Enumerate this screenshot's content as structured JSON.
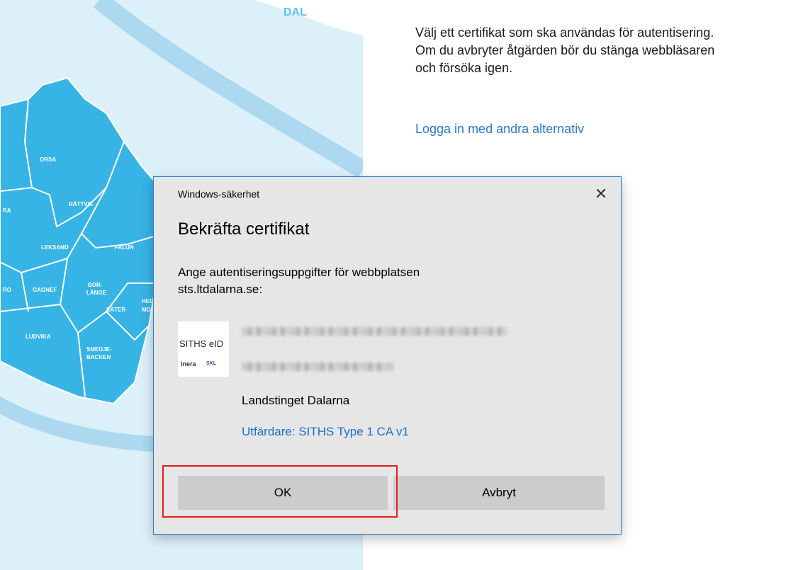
{
  "page": {
    "instruction_lines": [
      "Välj ett certifikat som ska användas för autentisering.",
      "Om du avbryter åtgärden bör du stänga webbläsaren",
      "och försöka igen."
    ],
    "alt_login_link": "Logga in med andra alternativ"
  },
  "map": {
    "logo_fragment": "DAL",
    "regions": [
      "ORSA",
      "RÄTTVIK",
      "LEKSAND",
      "FALUN",
      "GAGNEF",
      "BOR-",
      "LÄNGE",
      "SÄTER",
      "LUDVIKA",
      "SMEDJE-",
      "BACKEN",
      "RO",
      "RA",
      "HED",
      "MO"
    ],
    "colors": {
      "panel": "#dcf0fa",
      "river": "#acd9ef",
      "county": "#36b4e6",
      "border": "#ffffff"
    }
  },
  "dialog": {
    "window_title": "Windows-säkerhet",
    "close_symbol": "✕",
    "heading": "Bekräfta certifikat",
    "message_lines": [
      "Ange autentiseringsuppgifter för webbplatsen",
      "sts.ltdalarna.se:"
    ],
    "certificate": {
      "logo_text": "SITHS eID",
      "logo_brand": "inera",
      "logo_partner": "SKL",
      "organization": "Landstinget Dalarna",
      "issuer": "Utfärdare: SITHS Type 1 CA v1"
    },
    "buttons": {
      "ok": "OK",
      "cancel": "Avbryt"
    },
    "colors": {
      "background": "#e6e6e6",
      "accent_border": "#1f7fd1",
      "button": "#cccccc",
      "link": "#1a6fd0",
      "highlight": "#e0201b"
    }
  }
}
